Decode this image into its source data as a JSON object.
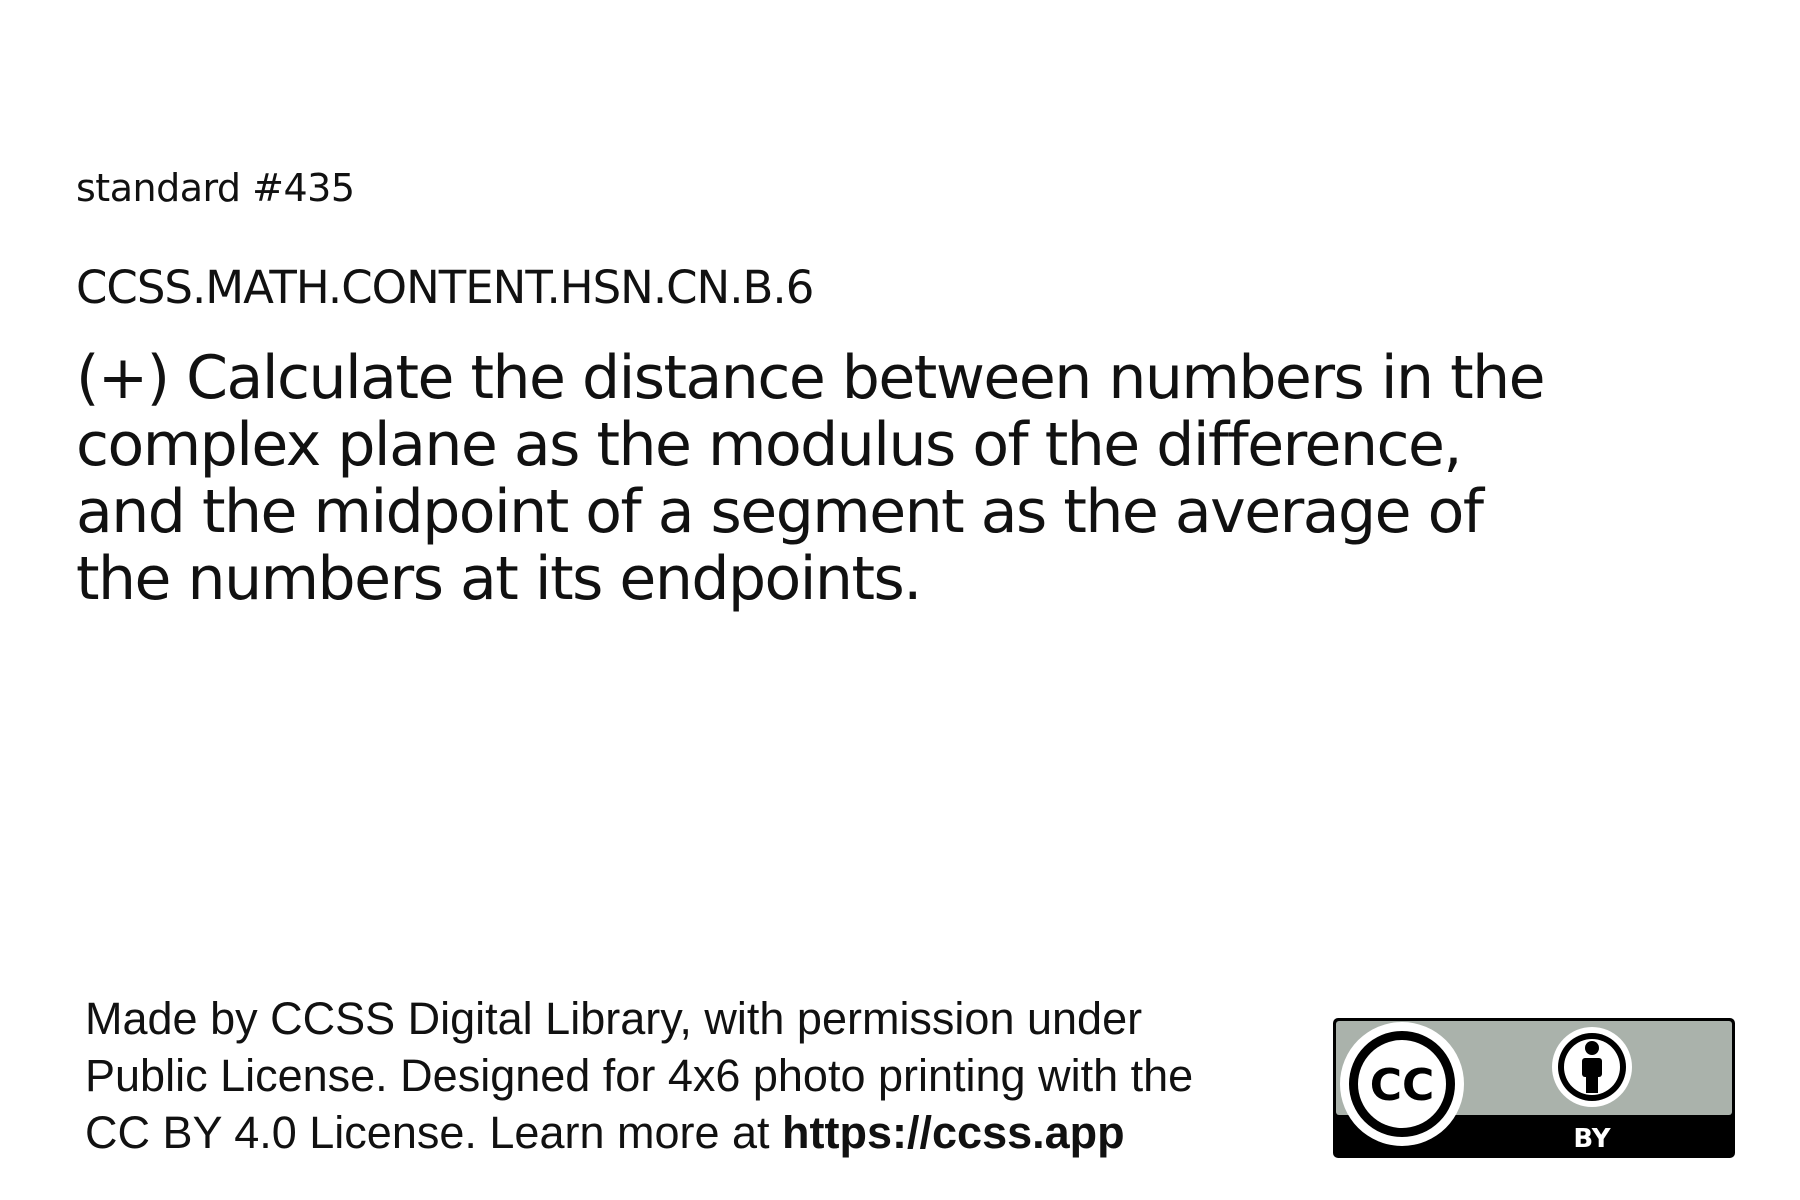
{
  "standard": {
    "number_label": "standard #435",
    "code": "CCSS.MATH.CONTENT.HSN.CN.B.6",
    "text_lines": [
      "(+) Calculate the distance between numbers in the",
      "complex plane as the modulus of the difference,",
      "and the midpoint of a segment as the average of",
      "the numbers at its endpoints."
    ]
  },
  "footer": {
    "lines": [
      "Made by CCSS Digital Library, with permission under",
      "Public License. Designed for 4x6 photo printing with the"
    ],
    "last_line_prefix": "CC BY 4.0 License. Learn more at ",
    "link_text": "https://ccss.app"
  },
  "license_badge": {
    "cc_label": "CC",
    "by_label": "BY",
    "colors": {
      "badge_gray": "#aab2ab",
      "badge_black": "#000000",
      "badge_white": "#ffffff"
    }
  }
}
